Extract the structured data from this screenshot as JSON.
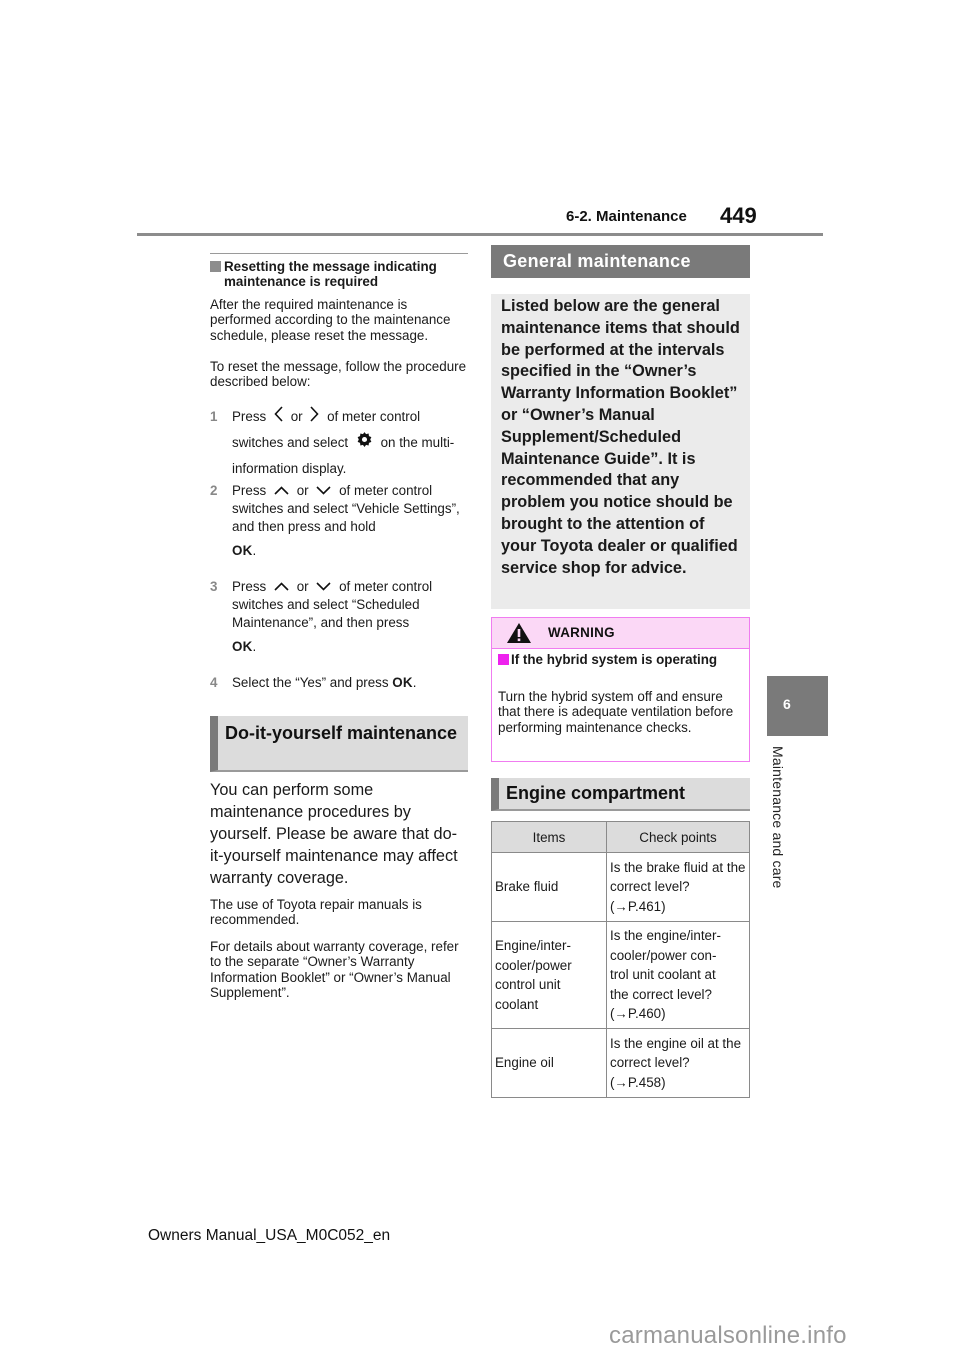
{
  "header": {
    "section": "6-2. Maintenance",
    "page_number": "449"
  },
  "side_tab": {
    "chapter_number": "6",
    "chapter_title": "Maintenance and care"
  },
  "left_column": {
    "subheading": "Resetting the message indicating maintenance is required",
    "intro_lines": [
      "After the required maintenance is performed according to the mainte-",
      "nance schedule, please reset the message."
    ],
    "intro_para1": "After the required maintenance is performed according to the maintenance schedule, please reset the message.",
    "intro_para2": "To reset the message, follow the procedure described below:",
    "steps": [
      {
        "num": "1",
        "pre": "Press",
        "icon1": "chevron-left-icon",
        "mid": "or",
        "icon2": "chevron-right-icon",
        "post": "of meter control switches and select",
        "icon3": "gear-icon",
        "end": "on the multi-information display."
      },
      {
        "num": "2",
        "pre": "Press",
        "icon1": "chevron-up-icon",
        "mid": "or",
        "icon2": "chevron-down-icon",
        "post": "of meter control switches and select “Vehicle Settings”, and then press and hold",
        "ok": "OK",
        "end": "."
      },
      {
        "num": "3",
        "pre": "Press",
        "icon1": "chevron-up-icon",
        "mid": "or",
        "icon2": "chevron-down-icon",
        "post": "of meter control switches and select “Scheduled Maintenance”, and then press",
        "ok": "OK",
        "end": "."
      },
      {
        "num": "4",
        "pre": "Select the “Yes” and press",
        "ok": "OK",
        "end": "."
      }
    ],
    "diy_heading": "Do-it-yourself maintenance",
    "diy_lead": "You can perform some maintenance procedures by yourself. Please be aware that do-it-yourself maintenance may affect warranty coverage.",
    "diy_para1": "The use of Toyota repair manuals is recommended.",
    "diy_para2": "For details about warranty coverage, refer to the separate “Owner’s Warranty Information Booklet” or “Owner’s Manual Supplement”."
  },
  "right_column": {
    "general_heading": "General maintenance",
    "general_text": "Listed below are the general maintenance items that should be performed at the intervals specified in the “Owner’s Warranty Information Booklet” or “Owner’s Manual Supplement/Scheduled Maintenance Guide”. It is recommended that any problem you notice should be brought to the attention of your Toyota dealer or qualified service shop for advice.",
    "warning": {
      "title": "WARNING",
      "subheading": "If the hybrid system is operating",
      "text": "Turn the hybrid system off and ensure that there is adequate ventilation before performing maintenance checks.",
      "accent_color": "#ee22ee"
    },
    "engine_heading": "Engine compartment",
    "table": {
      "columns": [
        "Items",
        "Check points"
      ],
      "rows": [
        {
          "item": "Brake fluid",
          "check": "Is the brake fluid at the correct level?\n(→P.461)"
        },
        {
          "item": "Engine/inter-\ncooler/power\ncontrol unit\ncoolant",
          "check": "Is the engine/inter-\ncooler/power con-\ntrol unit coolant at\nthe correct level?\n(→P.460)"
        },
        {
          "item": "Engine oil",
          "check": "Is the engine oil at the correct level?\n(→P.458)"
        }
      ]
    }
  },
  "footer": {
    "manual_id": "Owners Manual_USA_M0C052_en"
  },
  "watermark": "carmanualsonline.info"
}
